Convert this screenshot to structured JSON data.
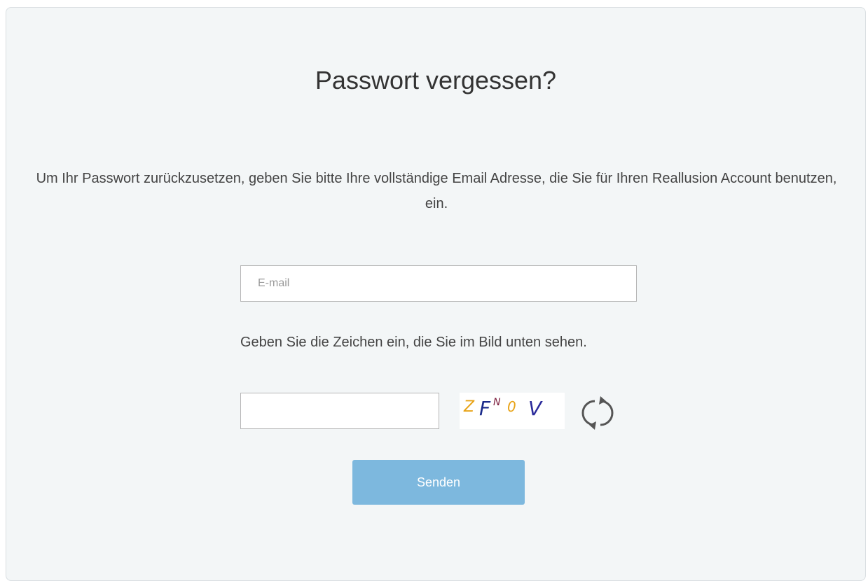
{
  "form": {
    "title": "Passwort vergessen?",
    "description": "Um Ihr Passwort zurückzusetzen, geben Sie bitte Ihre vollständige Email Adresse, die Sie für Ihren Reallusion Account benutzen, ein.",
    "email_placeholder": "E-mail",
    "email_value": "",
    "captcha_hint": "Geben Sie die Zeichen ein, die Sie im Bild unten sehen.",
    "captcha_value": "",
    "captcha_chars": [
      "Z",
      "F",
      "N",
      "0",
      "V"
    ],
    "refresh_icon": "refresh-icon",
    "submit_label": "Senden"
  },
  "colors": {
    "card_background": "#f3f6f7",
    "button_background": "#7db8de",
    "text": "#444444"
  }
}
